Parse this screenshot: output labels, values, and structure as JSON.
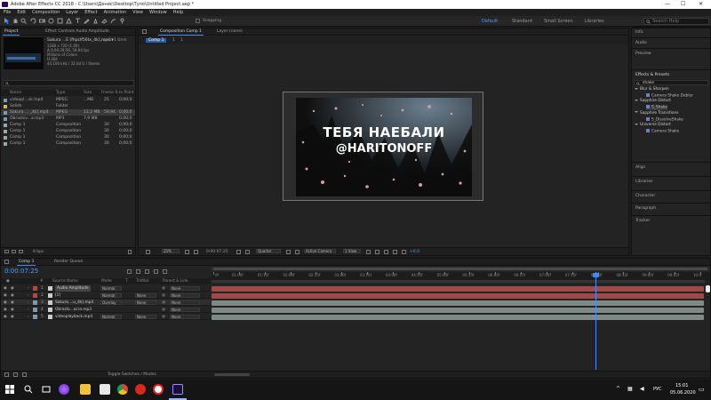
{
  "window": {
    "title": "Adobe After Effects CC 2018 - C:\\Users\\Денис\\Desktop\\Тупо\\Untitled Project.aep *"
  },
  "menu": [
    "File",
    "Edit",
    "Composition",
    "Layer",
    "Effect",
    "Animation",
    "View",
    "Window",
    "Help"
  ],
  "toolbar": {
    "snapping": "Snapping",
    "workspaces": [
      "Default",
      "Standard",
      "Small Screen",
      "Libraries"
    ],
    "search_placeholder": "Search Help"
  },
  "project_panel": {
    "tabs": [
      "Project",
      "Effect Controls Audio Amplitude"
    ],
    "preview": {
      "name": "Sakura ...E [fhpclf56tx_4k].mp4 ▾",
      "used": ", used 1 time",
      "dims": "1280 x 720 (1.00)",
      "duration": "Δ 0;00;39;56, 59.94 fps",
      "colors": "Millions of Colors",
      "codec": "H.264",
      "audio": "44,100 kHz / 32 bit U / Stereo"
    },
    "search_placeholder": "",
    "columns": [
      "Name",
      "Type",
      "Size",
      "Frame R...",
      "In Point"
    ],
    "items": [
      {
        "name": "videopl...ck.mp4",
        "type": "MPEG",
        "size": "...MB",
        "fps": "25",
        "in": "0;00;0"
      },
      {
        "name": "Solids",
        "type": "Folder",
        "size": "",
        "fps": "",
        "in": ""
      },
      {
        "name": "Sakura ... _4k].mp4",
        "type": "MPEG",
        "size": "12,2 MB",
        "fps": "59,94",
        "in": "0;00;0"
      },
      {
        "name": "Obrazlov...a.mp3",
        "type": "MP3",
        "size": "7,9 MB",
        "fps": "",
        "in": "0;00;0"
      },
      {
        "name": "Comp 1",
        "type": "Composition",
        "size": "",
        "fps": "30",
        "in": "0;00;0"
      },
      {
        "name": "Comp 1",
        "type": "Composition",
        "size": "",
        "fps": "30",
        "in": "0;00;0"
      },
      {
        "name": "Comp 1",
        "type": "Composition",
        "size": "",
        "fps": "30",
        "in": "0;00;0"
      },
      {
        "name": "Comp 1",
        "type": "Composition",
        "size": "",
        "fps": "30",
        "in": "0;00;0"
      }
    ],
    "bpc": "8 bpc"
  },
  "comp_viewer": {
    "tabs": [
      "Composition Comp 1",
      "Layer (none)"
    ],
    "breadcrumbs": [
      "Comp 1",
      "1",
      "1"
    ],
    "line1": "ТЕБЯ НАЕБАЛИ",
    "line2": "@HARITONOFF",
    "controls": {
      "zoom": "25%",
      "timecode": "0:00:07:25",
      "quality": "Quarter",
      "camera": "Active Camera",
      "view": "1 View",
      "exposure": "+0,0"
    }
  },
  "right_panel": {
    "items": [
      "Info",
      "Audio",
      "Preview",
      "Effects & Presets",
      "Align",
      "Libraries",
      "Character",
      "Paragraph",
      "Tracker"
    ],
    "search_value": "shake",
    "effects": [
      {
        "label": "Blur & Sharpen",
        "depth": 0
      },
      {
        "label": "Camera Shake Deblur",
        "depth": 1
      },
      {
        "label": "Sapphire Distort",
        "depth": 0
      },
      {
        "label": "S_Shake",
        "depth": 1
      },
      {
        "label": "Sapphire Transitions",
        "depth": 0
      },
      {
        "label": "S_DissolveShake",
        "depth": 1
      },
      {
        "label": "Universe Distort",
        "depth": 0
      },
      {
        "label": "Camera Shake",
        "depth": 1
      }
    ]
  },
  "timeline": {
    "tabs": [
      "Comp 1",
      "Render Queue"
    ],
    "timecode": "0:00:07:25",
    "columns": [
      "#",
      "Source Name",
      "Mode",
      "T",
      "TrkMat",
      "Parent & Link"
    ],
    "layers": [
      {
        "num": "1",
        "name": "Audio Amplitude",
        "mode": "Normal",
        "trkmat": "",
        "parent": "None",
        "color": "#c2403f"
      },
      {
        "num": "2",
        "name": "[1]",
        "mode": "Normal",
        "trkmat": "None",
        "parent": "None",
        "color": "#c2403f"
      },
      {
        "num": "3",
        "name": "Sakura ...u_4k].mp4",
        "mode": "Overlay",
        "trkmat": "None",
        "parent": "None",
        "color": "#7a9ab3"
      },
      {
        "num": "4",
        "name": "Obrazlo...ocra.mp3",
        "mode": "",
        "trkmat": "",
        "parent": "None",
        "color": "#7a9ab3"
      },
      {
        "num": "5",
        "name": "videoplayback.mp4",
        "mode": "Normal",
        "trkmat": "None",
        "parent": "None",
        "color": "#7a9ab3"
      }
    ],
    "ruler": [
      "0f",
      "01:00f",
      "01:15f",
      "02:00f",
      "02:15f",
      "03:00f",
      "03:15f",
      "04:00f",
      "04:15f",
      "05:00f",
      "05:15f",
      "06:00f",
      "06:15f",
      "07:00f",
      "07:15f",
      "08:00f",
      "08:15f",
      "09:00f",
      "09:15f",
      "10:0"
    ],
    "toggle_label": "Toggle Switches / Modes"
  },
  "taskbar": {
    "lang": "РУС",
    "time": "15:01",
    "date": "05.06.2020"
  },
  "colors": {
    "accent": "#3d8bff",
    "layer_red": "#9e4a48",
    "layer_gray": "#7f8a86"
  }
}
